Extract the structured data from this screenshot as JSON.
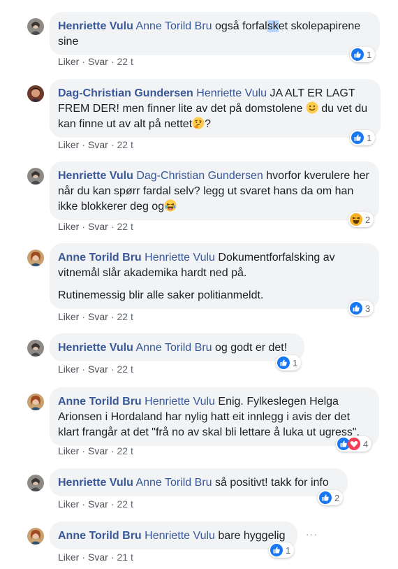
{
  "comments": [
    {
      "author": "Henriette Vulu",
      "mention": "Anne Torild Bru",
      "text_a": "også forfal",
      "text_hl": "sk",
      "text_b": "et skolepapirene sine",
      "reaction_count": "1",
      "like": "Liker",
      "reply": "Svar",
      "time": "22 t"
    },
    {
      "author": "Dag-Christian Gundersen",
      "mention": "Henriette Vulu",
      "text_a": "JA ALT ER LAGT FREM DER! men finner lite av det på domstolene",
      "text_b": "du vet du kan finne ut av alt på nettet",
      "text_c": "?",
      "reaction_count": "1",
      "like": "Liker",
      "reply": "Svar",
      "time": "22 t"
    },
    {
      "author": "Henriette Vulu",
      "mention": "Dag-Christian Gundersen",
      "text_a": "hvorfor kverulere her når du kan spørr fardal selv? legg ut svaret hans da om han ikke blokkerer deg og",
      "reaction_count": "2",
      "like": "Liker",
      "reply": "Svar",
      "time": "22 t"
    },
    {
      "author": "Anne Torild Bru",
      "mention": "Henriette Vulu",
      "text_a": "Dokumentforfalsking av vitnemål slår akademika hardt ned på.",
      "text_p2": "Rutinemessig blir alle saker politianmeldt.",
      "reaction_count": "3",
      "like": "Liker",
      "reply": "Svar",
      "time": "22 t"
    },
    {
      "author": "Henriette Vulu",
      "mention": "Anne Torild Bru",
      "text_a": "og godt er det!",
      "reaction_count": "1",
      "like": "Liker",
      "reply": "Svar",
      "time": "22 t"
    },
    {
      "author": "Anne Torild Bru",
      "mention": "Henriette Vulu",
      "text_a": "Enig. Fylkeslegen Helga Arionsen i Hordaland har nylig hatt eit innlegg i avis der det klart frangår at det \"frå no av skal bli lettare å luka ut ugress\".",
      "reaction_count": "4",
      "like": "Liker",
      "reply": "Svar",
      "time": "22 t"
    },
    {
      "author": "Henriette Vulu",
      "mention": "Anne Torild Bru",
      "text_a": "så positivt! takk for info",
      "reaction_count": "2",
      "like": "Liker",
      "reply": "Svar",
      "time": "22 t"
    },
    {
      "author": "Anne Torild Bru",
      "mention": "Henriette Vulu",
      "text_a": "bare hyggelig",
      "reaction_count": "1",
      "like": "Liker",
      "reply": "Svar",
      "time": "21 t",
      "more": "···"
    }
  ],
  "colors": {
    "link": "#385898",
    "bubble": "#f2f3f5",
    "like_blue": "#1877f2",
    "love_red": "#f33e58",
    "meta": "#606770"
  },
  "icons": [
    "like-icon",
    "love-icon",
    "haha-icon",
    "smile-emoji",
    "thinking-emoji",
    "laughing-emoji",
    "more-options-icon"
  ]
}
